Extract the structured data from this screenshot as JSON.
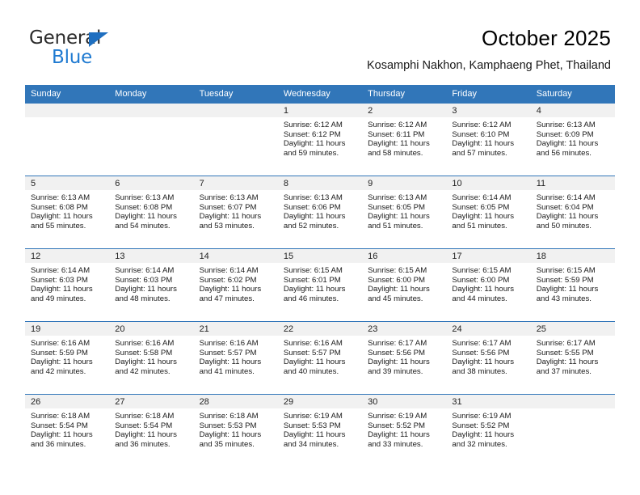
{
  "brand": {
    "name_part1": "General",
    "name_part2": "Blue",
    "accent_color": "#1f7ad1",
    "triangle_color": "#1f6fc0"
  },
  "header": {
    "title": "October 2025",
    "subtitle": "Kosamphi Nakhon, Kamphaeng Phet, Thailand",
    "header_bg": "#3176b9",
    "header_text_color": "#ffffff"
  },
  "weekdays": [
    "Sunday",
    "Monday",
    "Tuesday",
    "Wednesday",
    "Thursday",
    "Friday",
    "Saturday"
  ],
  "weeks": [
    [
      {
        "blank": true
      },
      {
        "blank": true
      },
      {
        "blank": true
      },
      {
        "day": "1",
        "sunrise": "Sunrise: 6:12 AM",
        "sunset": "Sunset: 6:12 PM",
        "daylight_l1": "Daylight: 11 hours",
        "daylight_l2": "and 59 minutes."
      },
      {
        "day": "2",
        "sunrise": "Sunrise: 6:12 AM",
        "sunset": "Sunset: 6:11 PM",
        "daylight_l1": "Daylight: 11 hours",
        "daylight_l2": "and 58 minutes."
      },
      {
        "day": "3",
        "sunrise": "Sunrise: 6:12 AM",
        "sunset": "Sunset: 6:10 PM",
        "daylight_l1": "Daylight: 11 hours",
        "daylight_l2": "and 57 minutes."
      },
      {
        "day": "4",
        "sunrise": "Sunrise: 6:13 AM",
        "sunset": "Sunset: 6:09 PM",
        "daylight_l1": "Daylight: 11 hours",
        "daylight_l2": "and 56 minutes."
      }
    ],
    [
      {
        "day": "5",
        "sunrise": "Sunrise: 6:13 AM",
        "sunset": "Sunset: 6:08 PM",
        "daylight_l1": "Daylight: 11 hours",
        "daylight_l2": "and 55 minutes."
      },
      {
        "day": "6",
        "sunrise": "Sunrise: 6:13 AM",
        "sunset": "Sunset: 6:08 PM",
        "daylight_l1": "Daylight: 11 hours",
        "daylight_l2": "and 54 minutes."
      },
      {
        "day": "7",
        "sunrise": "Sunrise: 6:13 AM",
        "sunset": "Sunset: 6:07 PM",
        "daylight_l1": "Daylight: 11 hours",
        "daylight_l2": "and 53 minutes."
      },
      {
        "day": "8",
        "sunrise": "Sunrise: 6:13 AM",
        "sunset": "Sunset: 6:06 PM",
        "daylight_l1": "Daylight: 11 hours",
        "daylight_l2": "and 52 minutes."
      },
      {
        "day": "9",
        "sunrise": "Sunrise: 6:13 AM",
        "sunset": "Sunset: 6:05 PM",
        "daylight_l1": "Daylight: 11 hours",
        "daylight_l2": "and 51 minutes."
      },
      {
        "day": "10",
        "sunrise": "Sunrise: 6:14 AM",
        "sunset": "Sunset: 6:05 PM",
        "daylight_l1": "Daylight: 11 hours",
        "daylight_l2": "and 51 minutes."
      },
      {
        "day": "11",
        "sunrise": "Sunrise: 6:14 AM",
        "sunset": "Sunset: 6:04 PM",
        "daylight_l1": "Daylight: 11 hours",
        "daylight_l2": "and 50 minutes."
      }
    ],
    [
      {
        "day": "12",
        "sunrise": "Sunrise: 6:14 AM",
        "sunset": "Sunset: 6:03 PM",
        "daylight_l1": "Daylight: 11 hours",
        "daylight_l2": "and 49 minutes."
      },
      {
        "day": "13",
        "sunrise": "Sunrise: 6:14 AM",
        "sunset": "Sunset: 6:03 PM",
        "daylight_l1": "Daylight: 11 hours",
        "daylight_l2": "and 48 minutes."
      },
      {
        "day": "14",
        "sunrise": "Sunrise: 6:14 AM",
        "sunset": "Sunset: 6:02 PM",
        "daylight_l1": "Daylight: 11 hours",
        "daylight_l2": "and 47 minutes."
      },
      {
        "day": "15",
        "sunrise": "Sunrise: 6:15 AM",
        "sunset": "Sunset: 6:01 PM",
        "daylight_l1": "Daylight: 11 hours",
        "daylight_l2": "and 46 minutes."
      },
      {
        "day": "16",
        "sunrise": "Sunrise: 6:15 AM",
        "sunset": "Sunset: 6:00 PM",
        "daylight_l1": "Daylight: 11 hours",
        "daylight_l2": "and 45 minutes."
      },
      {
        "day": "17",
        "sunrise": "Sunrise: 6:15 AM",
        "sunset": "Sunset: 6:00 PM",
        "daylight_l1": "Daylight: 11 hours",
        "daylight_l2": "and 44 minutes."
      },
      {
        "day": "18",
        "sunrise": "Sunrise: 6:15 AM",
        "sunset": "Sunset: 5:59 PM",
        "daylight_l1": "Daylight: 11 hours",
        "daylight_l2": "and 43 minutes."
      }
    ],
    [
      {
        "day": "19",
        "sunrise": "Sunrise: 6:16 AM",
        "sunset": "Sunset: 5:59 PM",
        "daylight_l1": "Daylight: 11 hours",
        "daylight_l2": "and 42 minutes."
      },
      {
        "day": "20",
        "sunrise": "Sunrise: 6:16 AM",
        "sunset": "Sunset: 5:58 PM",
        "daylight_l1": "Daylight: 11 hours",
        "daylight_l2": "and 42 minutes."
      },
      {
        "day": "21",
        "sunrise": "Sunrise: 6:16 AM",
        "sunset": "Sunset: 5:57 PM",
        "daylight_l1": "Daylight: 11 hours",
        "daylight_l2": "and 41 minutes."
      },
      {
        "day": "22",
        "sunrise": "Sunrise: 6:16 AM",
        "sunset": "Sunset: 5:57 PM",
        "daylight_l1": "Daylight: 11 hours",
        "daylight_l2": "and 40 minutes."
      },
      {
        "day": "23",
        "sunrise": "Sunrise: 6:17 AM",
        "sunset": "Sunset: 5:56 PM",
        "daylight_l1": "Daylight: 11 hours",
        "daylight_l2": "and 39 minutes."
      },
      {
        "day": "24",
        "sunrise": "Sunrise: 6:17 AM",
        "sunset": "Sunset: 5:56 PM",
        "daylight_l1": "Daylight: 11 hours",
        "daylight_l2": "and 38 minutes."
      },
      {
        "day": "25",
        "sunrise": "Sunrise: 6:17 AM",
        "sunset": "Sunset: 5:55 PM",
        "daylight_l1": "Daylight: 11 hours",
        "daylight_l2": "and 37 minutes."
      }
    ],
    [
      {
        "day": "26",
        "sunrise": "Sunrise: 6:18 AM",
        "sunset": "Sunset: 5:54 PM",
        "daylight_l1": "Daylight: 11 hours",
        "daylight_l2": "and 36 minutes."
      },
      {
        "day": "27",
        "sunrise": "Sunrise: 6:18 AM",
        "sunset": "Sunset: 5:54 PM",
        "daylight_l1": "Daylight: 11 hours",
        "daylight_l2": "and 36 minutes."
      },
      {
        "day": "28",
        "sunrise": "Sunrise: 6:18 AM",
        "sunset": "Sunset: 5:53 PM",
        "daylight_l1": "Daylight: 11 hours",
        "daylight_l2": "and 35 minutes."
      },
      {
        "day": "29",
        "sunrise": "Sunrise: 6:19 AM",
        "sunset": "Sunset: 5:53 PM",
        "daylight_l1": "Daylight: 11 hours",
        "daylight_l2": "and 34 minutes."
      },
      {
        "day": "30",
        "sunrise": "Sunrise: 6:19 AM",
        "sunset": "Sunset: 5:52 PM",
        "daylight_l1": "Daylight: 11 hours",
        "daylight_l2": "and 33 minutes."
      },
      {
        "day": "31",
        "sunrise": "Sunrise: 6:19 AM",
        "sunset": "Sunset: 5:52 PM",
        "daylight_l1": "Daylight: 11 hours",
        "daylight_l2": "and 32 minutes."
      },
      {
        "blank": true
      }
    ]
  ]
}
